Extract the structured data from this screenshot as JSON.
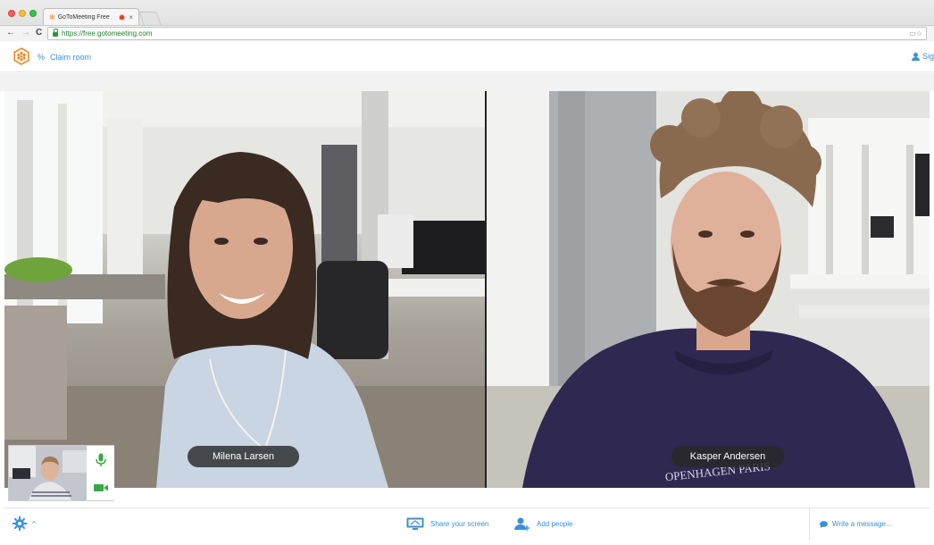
{
  "browser": {
    "tab_title": "GoToMeeting Free",
    "tab_close": "×",
    "url": "https://free.gotomeeting.com"
  },
  "header": {
    "claim_room": "Claim room",
    "sign_in_partial": "Sig"
  },
  "video": {
    "participants": [
      {
        "name": "Milena Larsen"
      },
      {
        "name": "Kasper Andersen"
      }
    ]
  },
  "toolbar": {
    "share_screen": "Share your screen",
    "add_people": "Add people",
    "write_message": "Write a message..."
  },
  "colors": {
    "accent": "#3b8fd8",
    "logo_orange": "#f08a24",
    "mic_green": "#3aa845",
    "url_green": "#1f7d2e"
  }
}
